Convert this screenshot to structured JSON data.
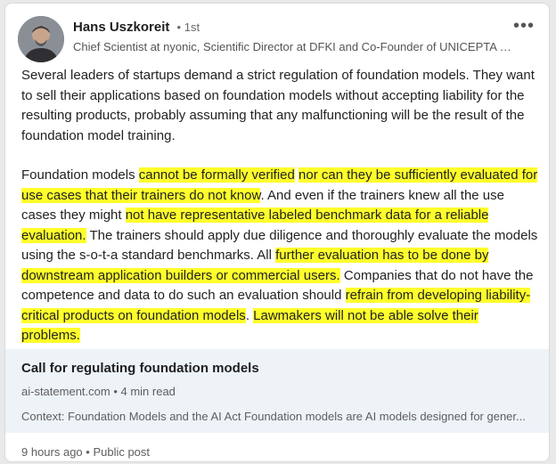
{
  "post": {
    "author": "Hans Uszkoreit",
    "degree": "• 1st",
    "headline": "Chief Scientist at nyonic, Scientific Director at DFKI and Co-Founder of UNICEPTA C...",
    "more_icon": "more-options-icon",
    "paragraph1": "Several leaders of startups demand a strict regulation of foundation models. They want to sell their applications based on foundation models without accepting liability for the resulting products, probably assuming that any malfunctioning will be the result of the foundation model training.",
    "p2": {
      "s1": "Foundation models ",
      "h1": "cannot be formally verified",
      "s2": " ",
      "h2": "nor can they be sufficiently evaluated for use cases that their trainers do not know",
      "s3": ". And even if the trainers knew all the use cases they might ",
      "h3": "not have representative labeled benchmark data for a reliable evaluation.",
      "s4": " The trainers should apply due diligence and thoroughly evaluate the models using the s-o-t-a standard benchmarks. All ",
      "h4": "further evaluation has to be done by downstream application builders or commercial users.",
      "s5": " Companies that do not have the competence and data to do such an evaluation should ",
      "h5": "refrain from developing liability-critical products on foundation models",
      "s6": ". ",
      "h6": "Lawmakers will not be able solve their problems."
    },
    "highlight_color": "#ffff2b",
    "link": {
      "title": "Call for regulating foundation models",
      "meta": "ai-statement.com • 4 min read",
      "description": "Context: Foundation Models and the AI Act Foundation models are AI models designed for gener..."
    },
    "footer": "9 hours ago • Public post"
  }
}
